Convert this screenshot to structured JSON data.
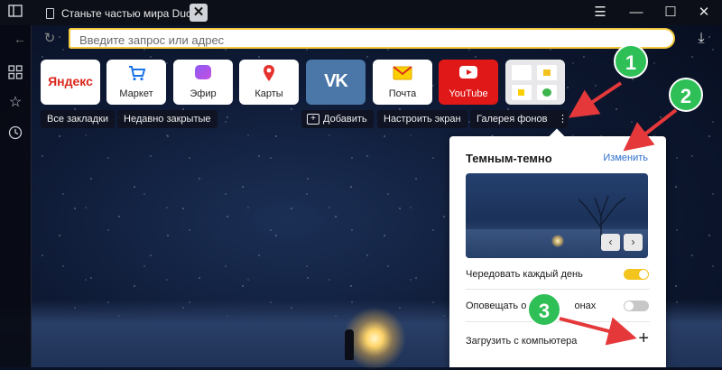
{
  "tab": {
    "title": "Станьте частью мира Duc"
  },
  "address": {
    "placeholder": "Введите запрос или адрес"
  },
  "tiles": [
    {
      "name": "Яндекс"
    },
    {
      "name": "Маркет"
    },
    {
      "name": "Эфир"
    },
    {
      "name": "Карты"
    },
    {
      "name": "VK"
    },
    {
      "name": "Почта"
    },
    {
      "name": "YouTube"
    }
  ],
  "bar": {
    "all_bookmarks": "Все закладки",
    "recently_closed": "Недавно закрытые",
    "add": "Добавить",
    "customize": "Настроить экран",
    "gallery": "Галерея фонов"
  },
  "popup": {
    "title": "Темным-темно",
    "change": "Изменить",
    "rotate_daily": "Чередовать каждый день",
    "notify": "Оповещать о н",
    "notify_tail": "онах",
    "upload": "Загрузить с компьютера",
    "rotate_on": true,
    "notify_on": false
  },
  "badges": [
    "1",
    "2",
    "3"
  ],
  "colors": {
    "accent": "#f3c83c",
    "badge": "#2fbf57",
    "arrow": "#e5383b"
  }
}
